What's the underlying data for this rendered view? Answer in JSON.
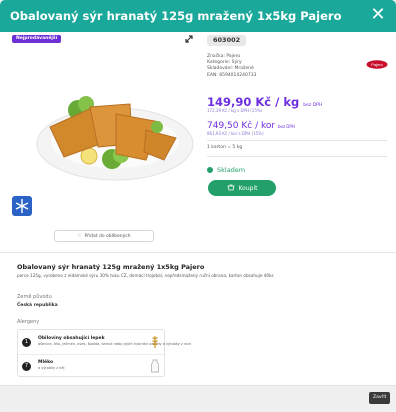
{
  "header": {
    "title": "Obalovaný sýr hranatý 125g mražený 1x5kg Pajero",
    "close_icon": "close-icon"
  },
  "badge": {
    "label": "Nejprodávanější"
  },
  "product": {
    "code": "603002",
    "meta": [
      "Značka: Pajero",
      "Kategorie: Sýry",
      "Skladování: Mražené",
      "EAN: 8594014240733"
    ],
    "price_per_kg": "149,90 Kč / kg",
    "price_per_kg_note": "bez DPH",
    "price_per_kg_vat": "172,39 Kč / kg s DPH (15%)",
    "price_per_box": "749,50 Kč / kor",
    "price_per_box_note": "bez DPH",
    "price_per_box_vat": "861,93 Kč / kor s DPH (15%)",
    "pack": "1 karton = 5 kg",
    "stock": "Skladem",
    "buy_label": "Koupit",
    "detail_button": "Přidat do oblíbených"
  },
  "description": {
    "title": "Obalovaný sýr hranatý 125g mražený 1x5kg Pajero",
    "text": "porce 125g, vyrobeno z eidamské sýru 30% tuku CZ, domácí trojobal, nepředsmažený ruční obrana, karton obsahuje 40ks",
    "origin_label": "Země původu",
    "origin_value": "Česká republika",
    "allergen_label": "Alergeny",
    "allergens": [
      {
        "num": "1",
        "name": "Obiloviny obsahující lepek",
        "sub": "pšenice, žito, ječmen, oves, špalda, kamut nebo jejich hybridní odrůdy a výrobky z nich"
      },
      {
        "num": "7",
        "name": "Mléko",
        "sub": "a výrobky z něj"
      }
    ]
  },
  "footer": {
    "close_label": "Zavřít"
  },
  "colors": {
    "header": "#1aa89a",
    "price": "#6e2fe0",
    "stock": "#24a06b",
    "buy": "#23a069",
    "badge": "#6d2fd6"
  }
}
